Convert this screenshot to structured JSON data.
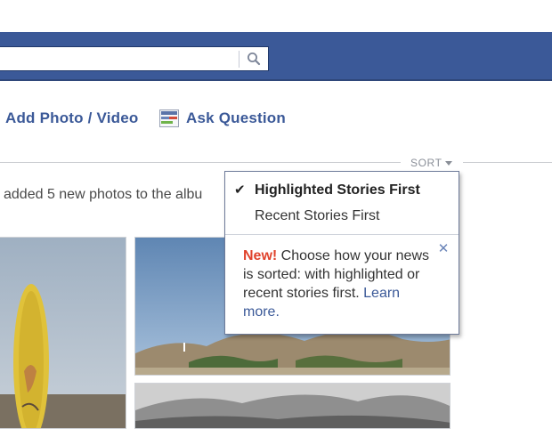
{
  "header": {
    "search": {
      "value": "",
      "placeholder": ""
    },
    "search_icon": "search-icon"
  },
  "composer": {
    "add_photo_label": "Add Photo / Video",
    "ask_question_label": "Ask Question",
    "ask_icon": "question-poll-icon"
  },
  "feed": {
    "sort_label": "SORT",
    "story_text": "added 5 new photos to the albu"
  },
  "sort_menu": {
    "items": [
      {
        "label": "Highlighted Stories First",
        "selected": true
      },
      {
        "label": "Recent Stories First",
        "selected": false
      }
    ],
    "tip": {
      "new_label": "New!",
      "text": " Choose how your news is sorted: with highlighted or recent stories first. ",
      "link": "Learn more."
    },
    "close_icon": "close-icon"
  },
  "colors": {
    "brand_blue": "#3b5998",
    "new_red": "#e0432c",
    "divider_gray": "#c9cbcf"
  }
}
